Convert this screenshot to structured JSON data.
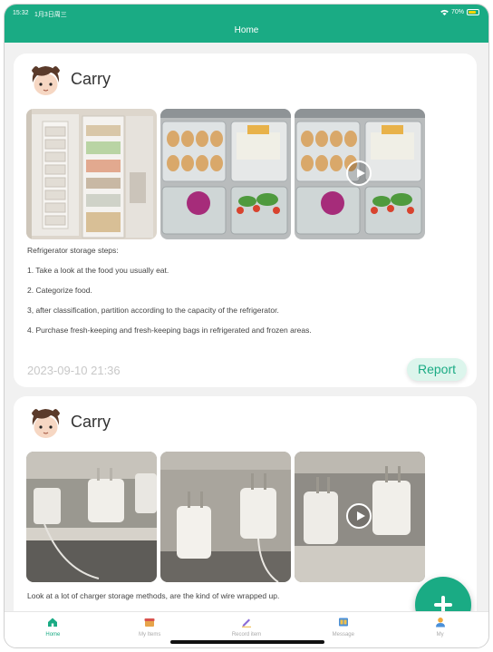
{
  "status_bar": {
    "time": "15:32",
    "date": "1月3日周三",
    "battery": "70%"
  },
  "header": {
    "title": "Home"
  },
  "posts": [
    {
      "username": "Carry",
      "description": [
        "Refrigerator storage steps:",
        "1. Take a look at the food you usually eat.",
        "2. Categorize food.",
        "3, after classification, partition according to the capacity of the refrigerator.",
        "4. Purchase fresh-keeping and fresh-keeping bags in refrigerated and frozen areas."
      ],
      "date": "2023-09-10 21:36",
      "report_label": "Report"
    },
    {
      "username": "Carry",
      "description": [
        "Look at a lot of charger storage methods, are the kind of wire wrapped up."
      ]
    }
  ],
  "tabs": [
    {
      "label": "Home",
      "icon": "home-icon",
      "active": true
    },
    {
      "label": "My Items",
      "icon": "box-icon",
      "active": false
    },
    {
      "label": "Record item",
      "icon": "pen-icon",
      "active": false
    },
    {
      "label": "Message",
      "icon": "message-icon",
      "active": false
    },
    {
      "label": "My",
      "icon": "person-icon",
      "active": false
    }
  ],
  "colors": {
    "accent": "#1aab84",
    "report_bg": "#dcf5ec",
    "date": "#c8c8c8"
  },
  "fab_icon": "plus-icon"
}
